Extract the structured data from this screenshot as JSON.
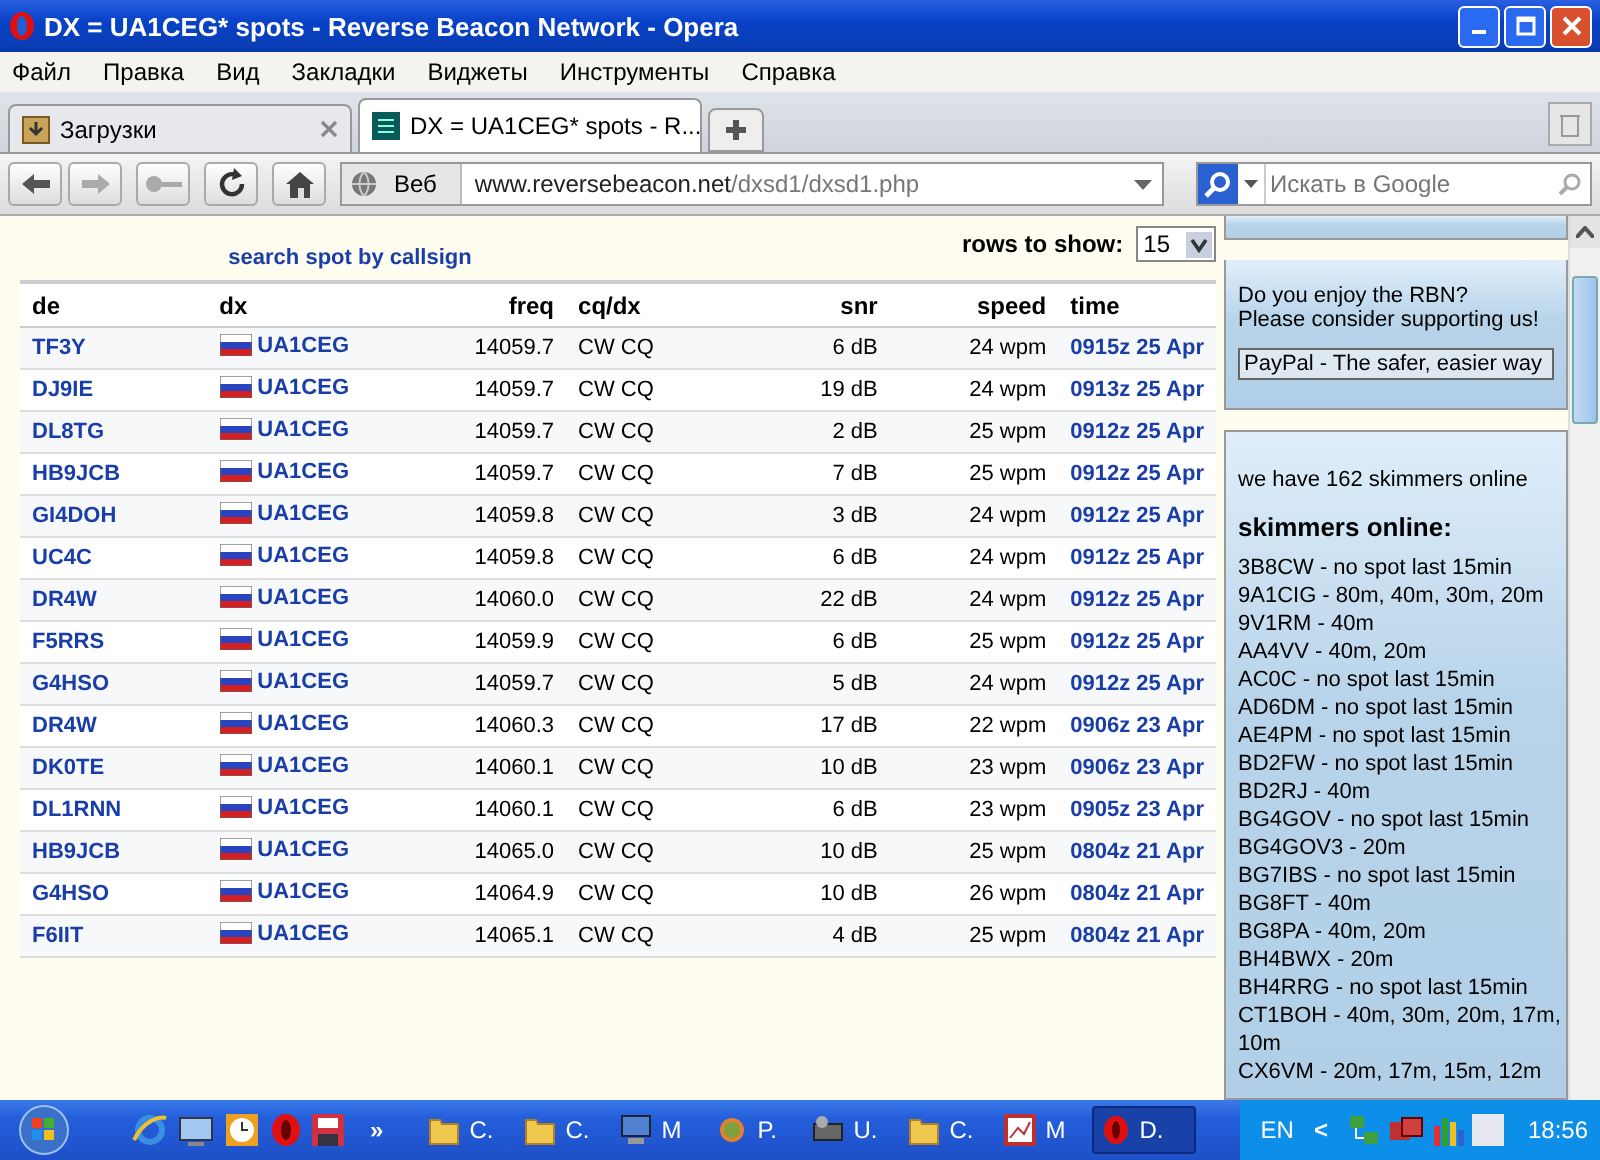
{
  "window": {
    "title": "DX = UA1CEG* spots - Reverse Beacon Network - Opera"
  },
  "menu": [
    "Файл",
    "Правка",
    "Вид",
    "Закладки",
    "Виджеты",
    "Инструменты",
    "Справка"
  ],
  "tabs": [
    {
      "label": "Загрузки",
      "kind": "downloads",
      "selected": false
    },
    {
      "label": "DX = UA1CEG* spots - R...",
      "kind": "page",
      "selected": true
    }
  ],
  "address": {
    "scheme_label": "Веб",
    "host": "www.reversebeacon.net",
    "path": "/dxsd1/dxsd1.php"
  },
  "search": {
    "placeholder": "Искать в Google"
  },
  "page": {
    "search_link": "search spot by callsign",
    "rows_label": "rows to show:",
    "rows_value": "15",
    "table": {
      "columns": [
        "de",
        "dx",
        "freq",
        "cq/dx",
        "snr",
        "speed",
        "time"
      ],
      "rows": [
        [
          "TF3Y",
          "UA1CEG",
          "14059.7",
          "CW CQ",
          "6 dB",
          "24 wpm",
          "0915z 25 Apr"
        ],
        [
          "DJ9IE",
          "UA1CEG",
          "14059.7",
          "CW CQ",
          "19 dB",
          "24 wpm",
          "0913z 25 Apr"
        ],
        [
          "DL8TG",
          "UA1CEG",
          "14059.7",
          "CW CQ",
          "2 dB",
          "25 wpm",
          "0912z 25 Apr"
        ],
        [
          "HB9JCB",
          "UA1CEG",
          "14059.7",
          "CW CQ",
          "7 dB",
          "25 wpm",
          "0912z 25 Apr"
        ],
        [
          "GI4DOH",
          "UA1CEG",
          "14059.8",
          "CW CQ",
          "3 dB",
          "24 wpm",
          "0912z 25 Apr"
        ],
        [
          "UC4C",
          "UA1CEG",
          "14059.8",
          "CW CQ",
          "6 dB",
          "24 wpm",
          "0912z 25 Apr"
        ],
        [
          "DR4W",
          "UA1CEG",
          "14060.0",
          "CW CQ",
          "22 dB",
          "24 wpm",
          "0912z 25 Apr"
        ],
        [
          "F5RRS",
          "UA1CEG",
          "14059.9",
          "CW CQ",
          "6 dB",
          "25 wpm",
          "0912z 25 Apr"
        ],
        [
          "G4HSO",
          "UA1CEG",
          "14059.7",
          "CW CQ",
          "5 dB",
          "24 wpm",
          "0912z 25 Apr"
        ],
        [
          "DR4W",
          "UA1CEG",
          "14060.3",
          "CW CQ",
          "17 dB",
          "22 wpm",
          "0906z 23 Apr"
        ],
        [
          "DK0TE",
          "UA1CEG",
          "14060.1",
          "CW CQ",
          "10 dB",
          "23 wpm",
          "0906z 23 Apr"
        ],
        [
          "DL1RNN",
          "UA1CEG",
          "14060.1",
          "CW CQ",
          "6 dB",
          "23 wpm",
          "0905z 23 Apr"
        ],
        [
          "HB9JCB",
          "UA1CEG",
          "14065.0",
          "CW CQ",
          "10 dB",
          "25 wpm",
          "0804z 21 Apr"
        ],
        [
          "G4HSO",
          "UA1CEG",
          "14064.9",
          "CW CQ",
          "10 dB",
          "26 wpm",
          "0804z 21 Apr"
        ],
        [
          "F6IIT",
          "UA1CEG",
          "14065.1",
          "CW CQ",
          "4 dB",
          "25 wpm",
          "0804z 21 Apr"
        ]
      ]
    }
  },
  "sidebar": {
    "support_lines": [
      "Do you enjoy the RBN?",
      "Please consider supporting us!"
    ],
    "paypal_value": "PayPal - The safer, easier way",
    "skimmers_count": "we have 162 skimmers online",
    "skimmers_heading": "skimmers online:",
    "skimmers": [
      "3B8CW - no spot last 15min",
      "9A1CIG - 80m, 40m, 30m, 20m",
      "9V1RM - 40m",
      "AA4VV - 40m, 20m",
      "AC0C - no spot last 15min",
      "AD6DM - no spot last 15min",
      "AE4PM - no spot last 15min",
      "BD2FW - no spot last 15min",
      "BD2RJ - 40m",
      "BG4GOV - no spot last 15min",
      "BG4GOV3 - 20m",
      "BG7IBS - no spot last 15min",
      "BG8FT - 40m",
      "BG8PA - 40m, 20m",
      "BH4BWX - 20m",
      "BH4RRG - no spot last 15min",
      "CT1BOH - 40m, 30m, 20m, 17m,",
      "10m",
      "CX6VM - 20m, 17m, 15m, 12m"
    ]
  },
  "taskbar": {
    "quick_launch": [
      {
        "kind": "browser"
      },
      {
        "kind": "desktop"
      },
      {
        "kind": "clock"
      },
      {
        "kind": "opera"
      },
      {
        "kind": "disk"
      }
    ],
    "more": "»",
    "tasks": [
      {
        "label": "C.",
        "kind": "folder",
        "selected": false
      },
      {
        "label": "C.",
        "kind": "folder",
        "selected": false
      },
      {
        "label": "M",
        "kind": "computer",
        "selected": false
      },
      {
        "label": "P.",
        "kind": "app",
        "selected": false
      },
      {
        "label": "U.",
        "kind": "drive",
        "selected": false
      },
      {
        "label": "C.",
        "kind": "folder",
        "selected": false
      },
      {
        "label": "M",
        "kind": "chart",
        "selected": false
      },
      {
        "label": "D.",
        "kind": "opera",
        "selected": true
      }
    ],
    "language": "EN",
    "tray_toggle": "<",
    "clock": "18:56"
  }
}
